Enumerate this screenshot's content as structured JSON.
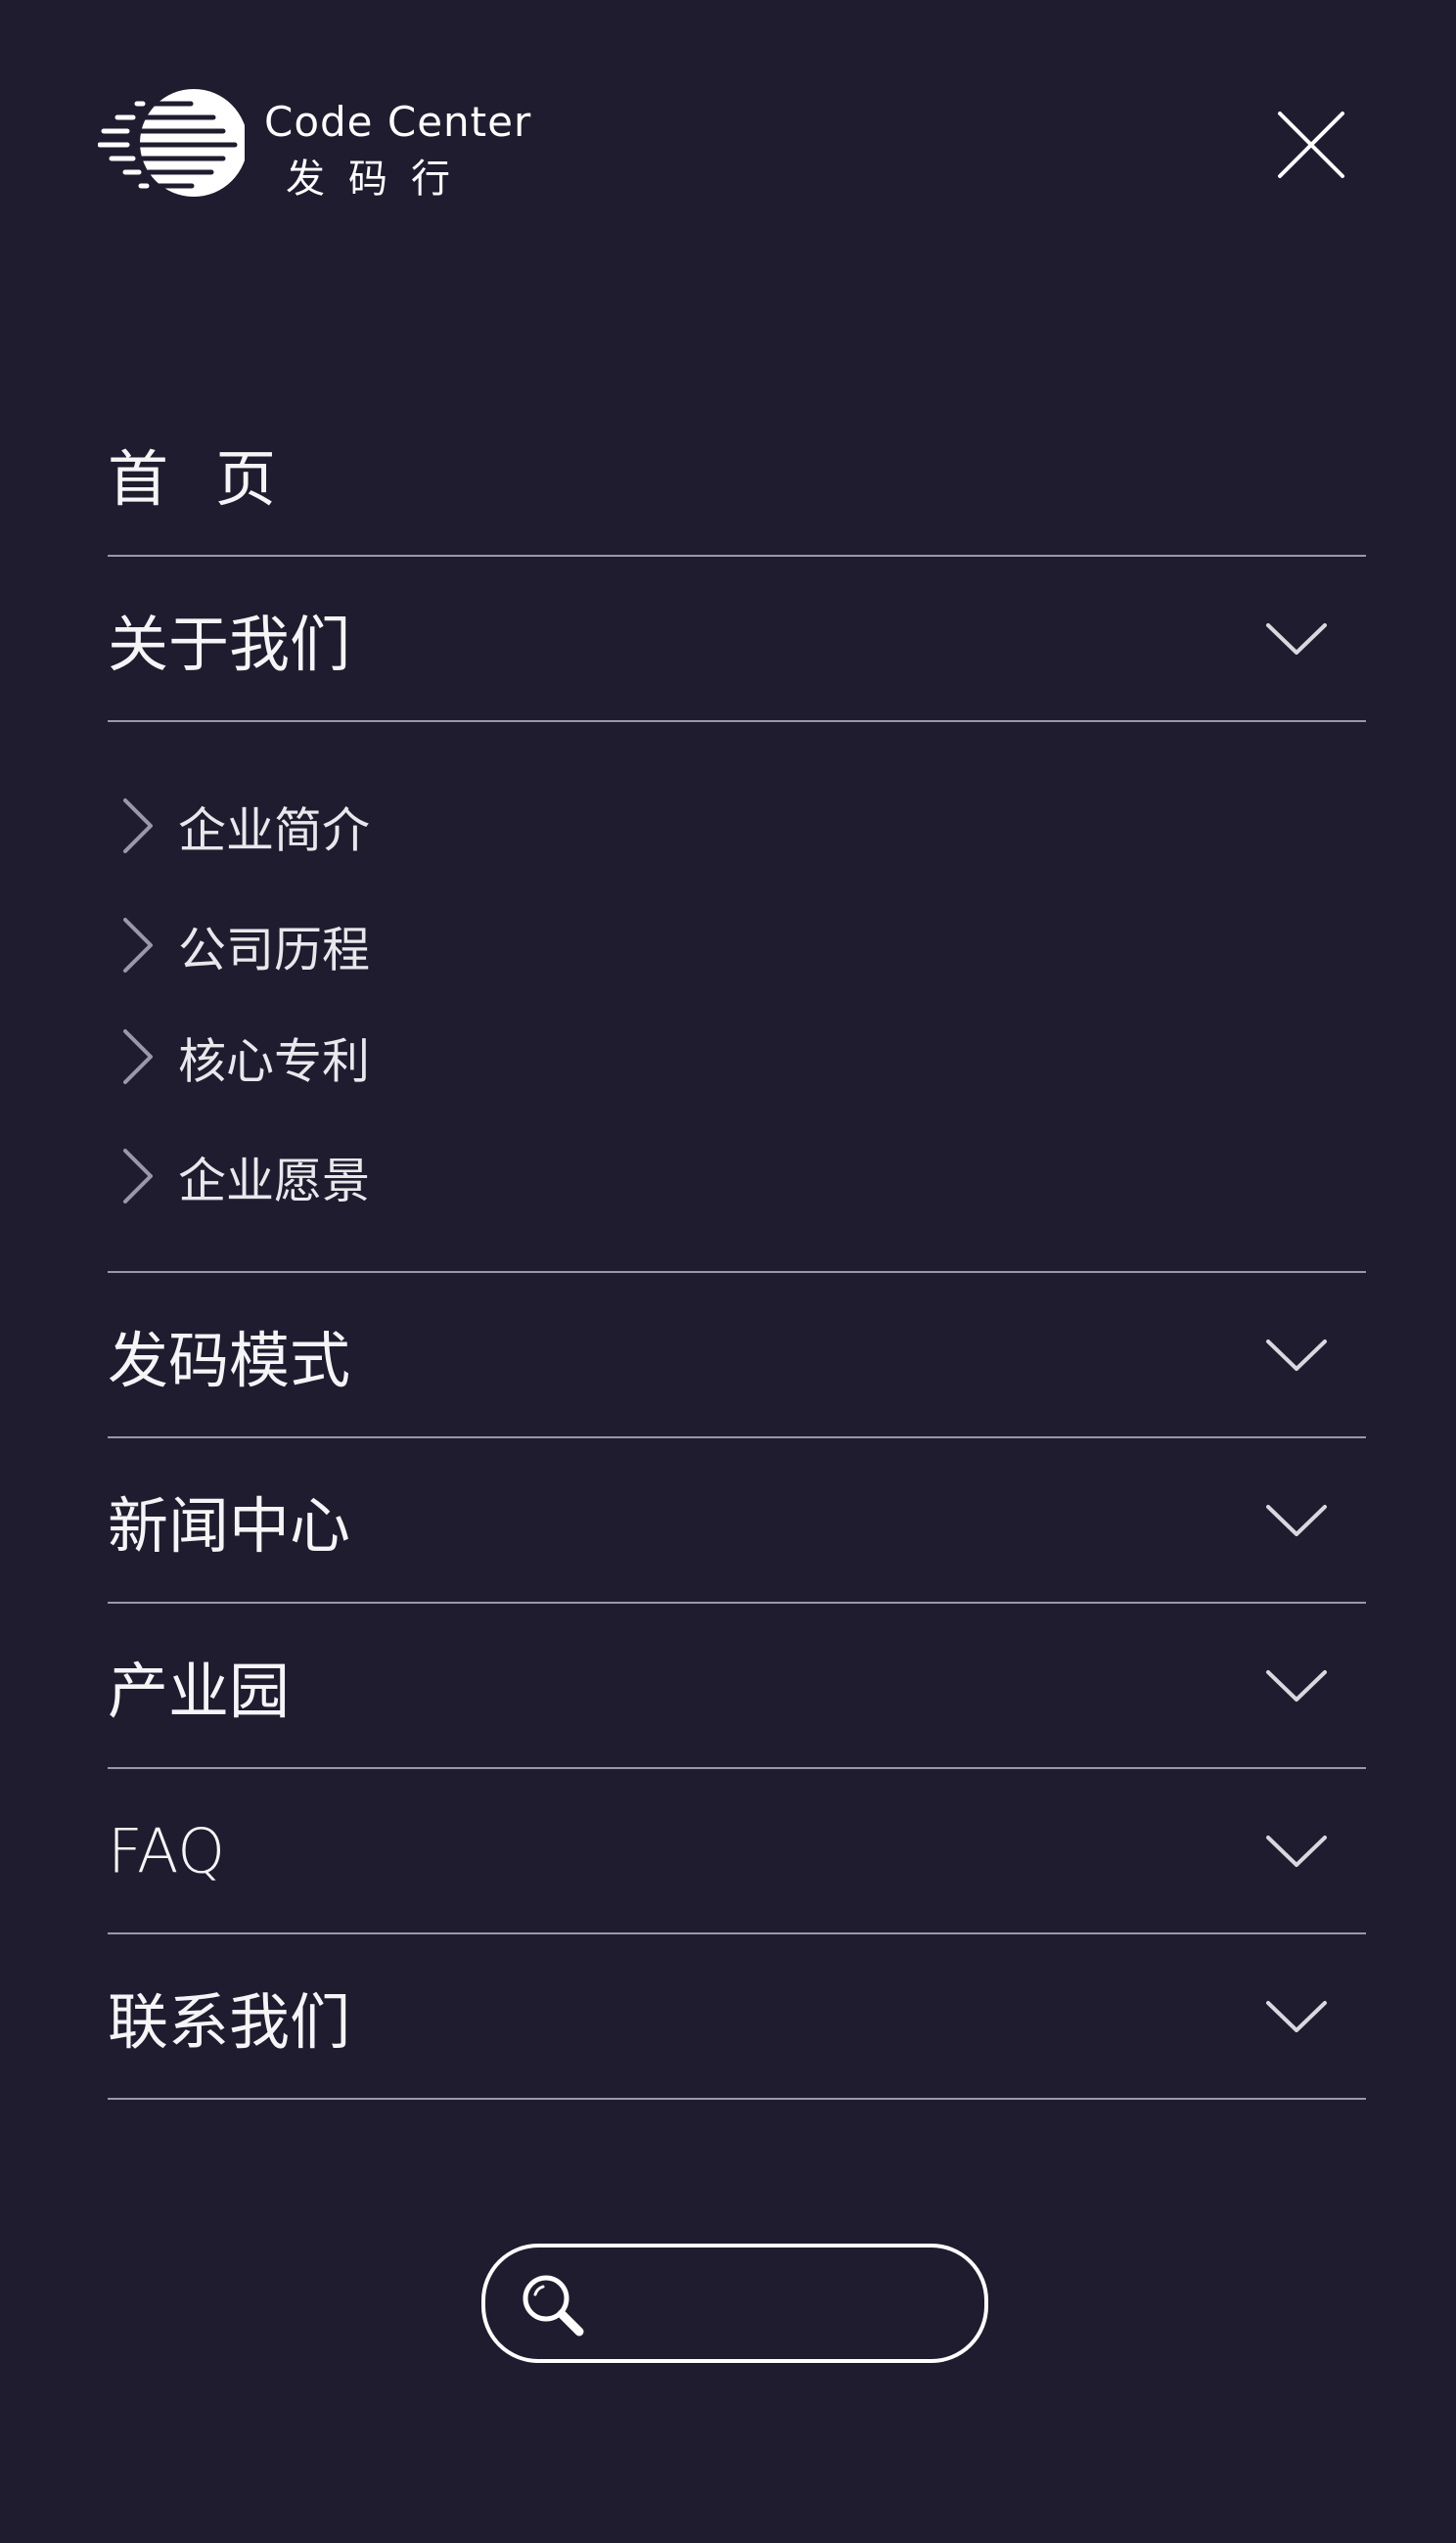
{
  "brand": {
    "name_en": "Code Center",
    "name_cn": "发码行"
  },
  "menu": {
    "items": [
      {
        "label": "首页",
        "expandable": false
      },
      {
        "label": "关于我们",
        "expandable": true,
        "expanded": true
      },
      {
        "label": "发码模式",
        "expandable": true
      },
      {
        "label": "新闻中心",
        "expandable": true
      },
      {
        "label": "产业园",
        "expandable": true
      },
      {
        "label": "FAQ",
        "expandable": true
      },
      {
        "label": "联系我们",
        "expandable": true
      }
    ],
    "about_sub": [
      {
        "label": "企业简介"
      },
      {
        "label": "公司历程"
      },
      {
        "label": "核心专利"
      },
      {
        "label": "企业愿景"
      }
    ]
  },
  "search": {
    "placeholder": ""
  },
  "colors": {
    "background": "#1f1c2f",
    "divider": "#9a98a8",
    "text": "#ffffff"
  },
  "icons": {
    "close": "close-icon",
    "expand": "chevron-down-icon",
    "sub": "chevron-right-icon",
    "search": "search-icon"
  }
}
